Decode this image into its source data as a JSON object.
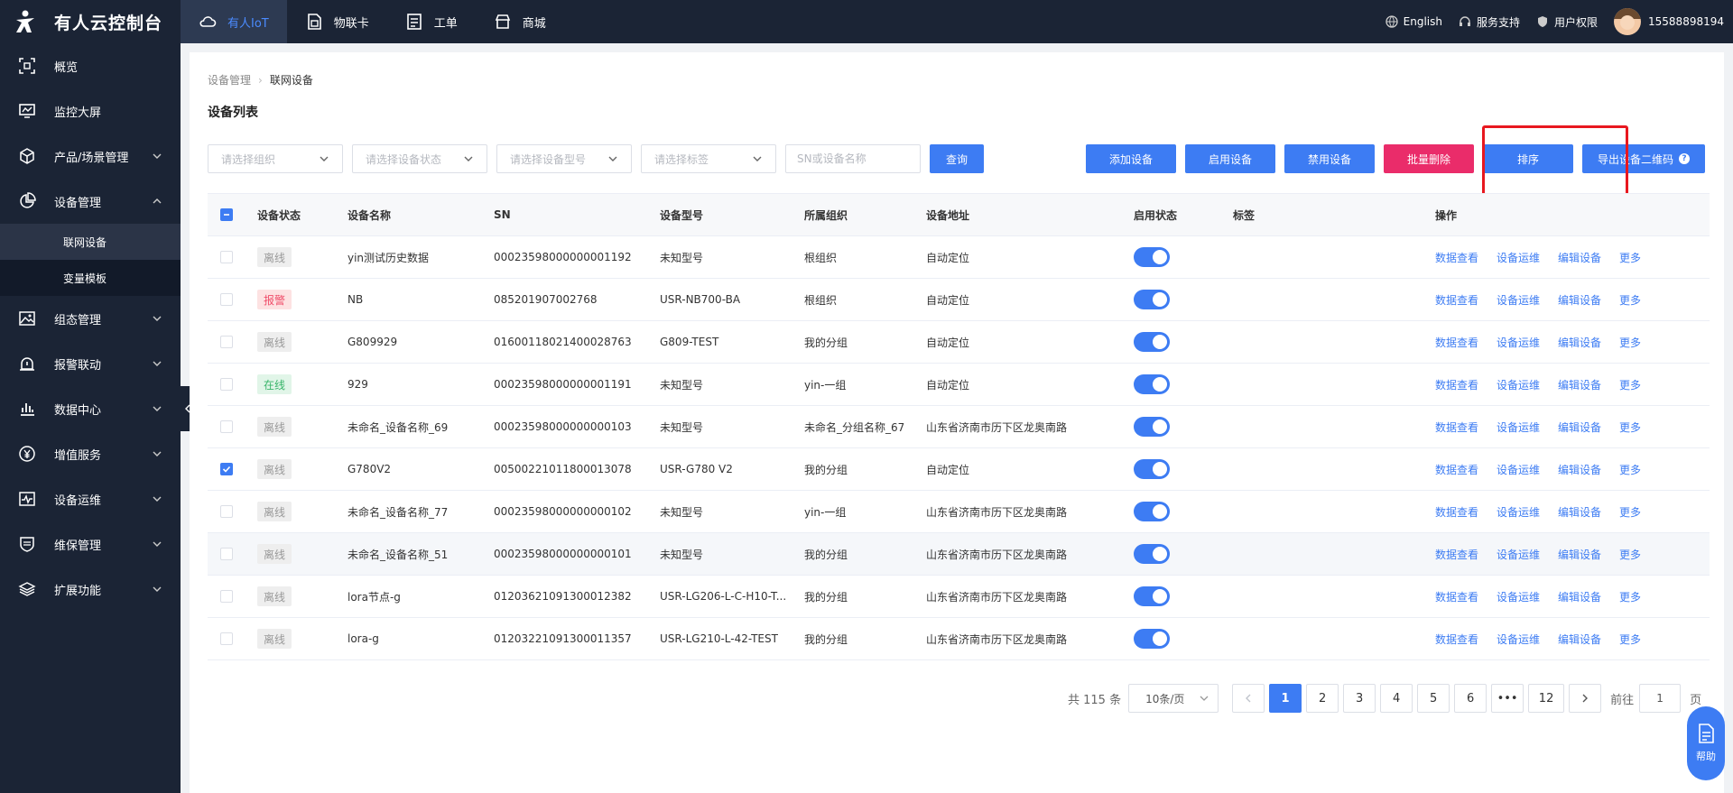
{
  "app": {
    "brand": "有人云控制台"
  },
  "topnav": [
    {
      "label": "有人IoT",
      "icon": "cloud-icon",
      "active": true
    },
    {
      "label": "物联卡",
      "icon": "sim-card-icon",
      "active": false
    },
    {
      "label": "工单",
      "icon": "ticket-icon",
      "active": false
    },
    {
      "label": "商城",
      "icon": "shop-icon",
      "active": false
    }
  ],
  "topright": {
    "language": "English",
    "support": "服务支持",
    "permissions": "用户权限",
    "username": "15588898194"
  },
  "sidebar": {
    "items": [
      {
        "label": "概览",
        "icon": "overview-icon"
      },
      {
        "label": "监控大屏",
        "icon": "monitor-icon"
      },
      {
        "label": "产品/场景管理",
        "icon": "cube-icon"
      },
      {
        "label": "设备管理",
        "icon": "pie-icon"
      },
      {
        "label": "组态管理",
        "icon": "image-icon"
      },
      {
        "label": "报警联动",
        "icon": "alarm-icon"
      },
      {
        "label": "数据中心",
        "icon": "bar-chart-icon"
      },
      {
        "label": "增值服务",
        "icon": "yen-icon"
      },
      {
        "label": "设备运维",
        "icon": "pulse-icon"
      },
      {
        "label": "维保管理",
        "icon": "shield-icon"
      },
      {
        "label": "扩展功能",
        "icon": "layers-icon"
      }
    ],
    "subitems": [
      {
        "label": "联网设备",
        "active": true
      },
      {
        "label": "变量模板",
        "active": false
      }
    ]
  },
  "breadcrumb": {
    "parent": "设备管理",
    "current": "联网设备"
  },
  "page_title": "设备列表",
  "filters": {
    "org_placeholder": "请选择组织",
    "status_placeholder": "请选择设备状态",
    "model_placeholder": "请选择设备型号",
    "tag_placeholder": "请选择标签",
    "sn_placeholder": "SN或设备名称",
    "query_label": "查询"
  },
  "actions": {
    "add": "添加设备",
    "enable": "启用设备",
    "disable": "禁用设备",
    "batch_delete": "批量删除",
    "sort": "排序",
    "export_qr": "导出设备二维码"
  },
  "table": {
    "headers": {
      "status": "设备状态",
      "name": "设备名称",
      "sn": "SN",
      "model": "设备型号",
      "org": "所属组织",
      "address": "设备地址",
      "enabled": "启用状态",
      "tag": "标签",
      "ops": "操作"
    },
    "ops": {
      "view": "数据查看",
      "maint": "设备运维",
      "edit": "编辑设备",
      "more": "更多"
    },
    "rows": [
      {
        "checked": false,
        "status": "离线",
        "status_type": "offline",
        "name": "yin测试历史数据",
        "sn": "00023598000000001192",
        "model": "未知型号",
        "org": "根组织",
        "address": "自动定位",
        "enabled": true,
        "tag": ""
      },
      {
        "checked": false,
        "status": "报警",
        "status_type": "alarm",
        "name": "NB",
        "sn": "085201907002768",
        "model": "USR-NB700-BA",
        "org": "根组织",
        "address": "自动定位",
        "enabled": true,
        "tag": ""
      },
      {
        "checked": false,
        "status": "离线",
        "status_type": "offline",
        "name": "G809929",
        "sn": "01600118021400028763",
        "model": "G809-TEST",
        "org": "我的分组",
        "address": "自动定位",
        "enabled": true,
        "tag": ""
      },
      {
        "checked": false,
        "status": "在线",
        "status_type": "online",
        "name": "929",
        "sn": "00023598000000001191",
        "model": "未知型号",
        "org": "yin-一组",
        "address": "自动定位",
        "enabled": true,
        "tag": ""
      },
      {
        "checked": false,
        "status": "离线",
        "status_type": "offline",
        "name": "未命名_设备名称_69",
        "sn": "00023598000000000103",
        "model": "未知型号",
        "org": "未命名_分组名称_67",
        "address": "山东省济南市历下区龙奥南路",
        "enabled": true,
        "tag": ""
      },
      {
        "checked": true,
        "status": "离线",
        "status_type": "offline",
        "name": "G780V2",
        "sn": "00500221011800013078",
        "model": "USR-G780 V2",
        "org": "我的分组",
        "address": "自动定位",
        "enabled": true,
        "tag": ""
      },
      {
        "checked": false,
        "status": "离线",
        "status_type": "offline",
        "name": "未命名_设备名称_77",
        "sn": "00023598000000000102",
        "model": "未知型号",
        "org": "yin-一组",
        "address": "山东省济南市历下区龙奥南路",
        "enabled": true,
        "tag": ""
      },
      {
        "checked": false,
        "status": "离线",
        "status_type": "offline",
        "name": "未命名_设备名称_51",
        "sn": "00023598000000000101",
        "model": "未知型号",
        "org": "我的分组",
        "address": "山东省济南市历下区龙奥南路",
        "enabled": true,
        "tag": "",
        "hover": true
      },
      {
        "checked": false,
        "status": "离线",
        "status_type": "offline",
        "name": "lora节点-g",
        "sn": "01203621091300012382",
        "model": "USR-LG206-L-C-H10-T...",
        "org": "我的分组",
        "address": "山东省济南市历下区龙奥南路",
        "enabled": true,
        "tag": ""
      },
      {
        "checked": false,
        "status": "离线",
        "status_type": "offline",
        "name": "lora-g",
        "sn": "01203221091300011357",
        "model": "USR-LG210-L-42-TEST",
        "org": "我的分组",
        "address": "山东省济南市历下区龙奥南路",
        "enabled": true,
        "tag": ""
      }
    ]
  },
  "pagination": {
    "total_text": "共 115 条",
    "page_size": "10条/页",
    "pages": [
      "1",
      "2",
      "3",
      "4",
      "5",
      "6",
      "•••",
      "12"
    ],
    "current": "1",
    "goto_prefix": "前往",
    "goto_value": "1",
    "goto_suffix": "页"
  },
  "help": {
    "label": "帮助"
  },
  "colors": {
    "primary": "#3d7cf3",
    "danger": "#ea2c6a",
    "sidebar": "#1b2435",
    "highlight": "#e8181f"
  }
}
